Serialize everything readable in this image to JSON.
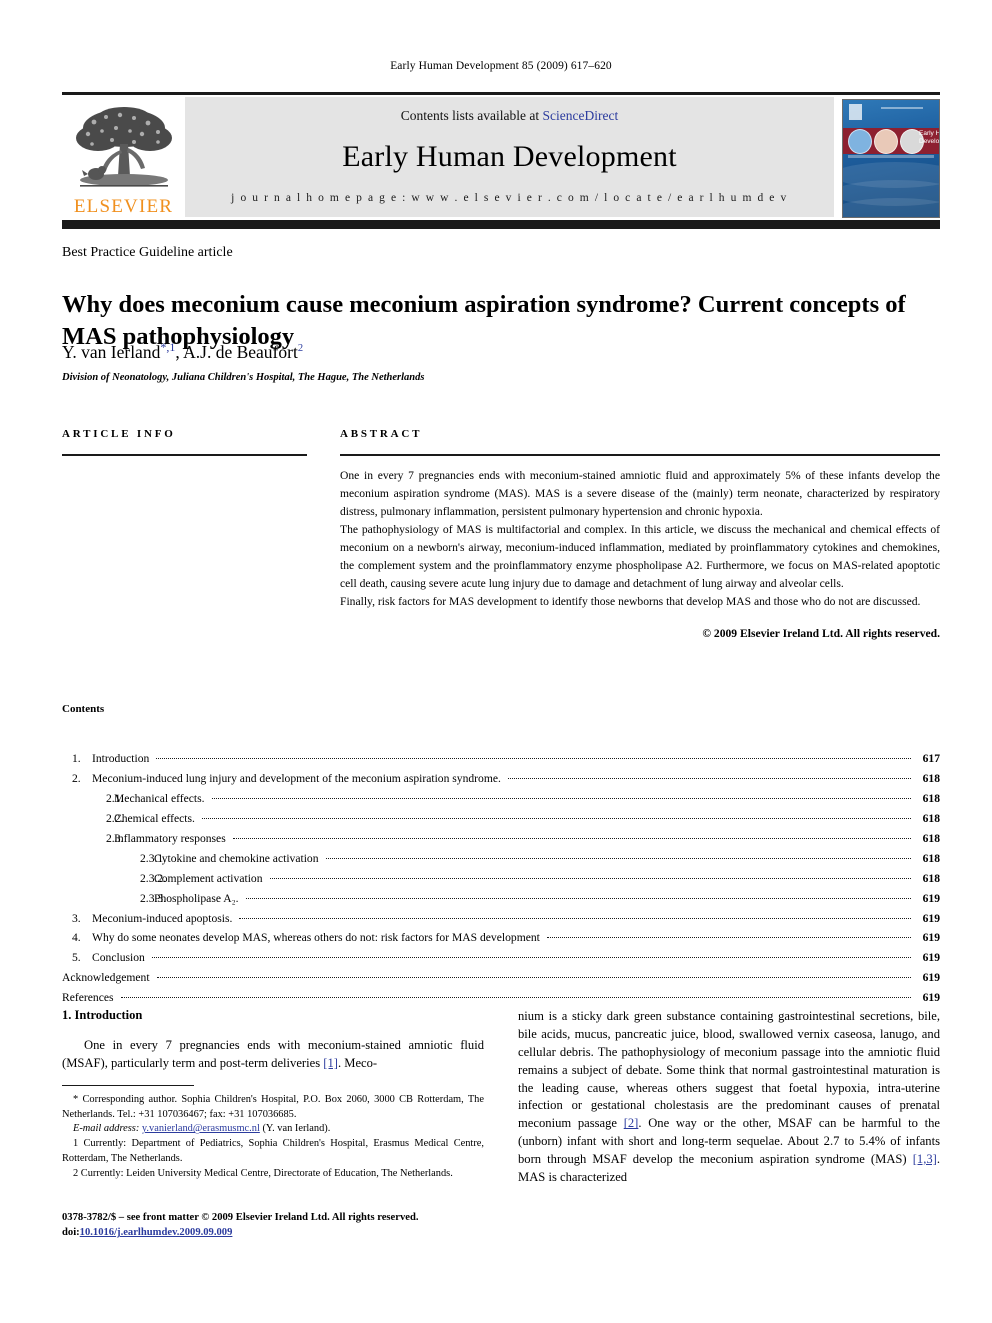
{
  "running_head": "Early Human Development 85 (2009) 617–620",
  "masthead": {
    "contents_prefix": "Contents lists available at ",
    "sciencedirect": "ScienceDirect",
    "journal_title": "Early Human Development",
    "homepage": "j o u r n a l   h o m e p a g e :   w w w . e l s e v i e r . c o m / l o c a t e / e a r l h u m d e v",
    "publisher_word": "ELSEVIER",
    "publisher_logo_icon": "elsevier-tree-icon",
    "cover_title_line1": "Early Human",
    "cover_title_line2": "Development",
    "accent_link_color": "#2b3b9e",
    "elsevier_orange": "#f0901e",
    "cover_band_color": "#8d2030"
  },
  "article": {
    "type": "Best Practice Guideline article",
    "title": "Why does meconium cause meconium aspiration syndrome? Current concepts of MAS pathophysiology",
    "author1": "Y. van Ierland",
    "author1_marks": "*,1",
    "author_sep": ", ",
    "author2": "A.J. de Beaufort",
    "author2_marks": "2",
    "affiliation": "Division of Neonatology, Juliana Children's Hospital, The Hague, The Netherlands"
  },
  "info_abstract": {
    "info_heading": "ARTICLE INFO",
    "abstract_heading": "ABSTRACT",
    "abstract_paragraphs": [
      "One in every 7 pregnancies ends with meconium-stained amniotic fluid and approximately 5% of these infants develop the meconium aspiration syndrome (MAS). MAS is a severe disease of the (mainly) term neonate, characterized by respiratory distress, pulmonary inflammation, persistent pulmonary hypertension and chronic hypoxia.",
      "The pathophysiology of MAS is multifactorial and complex. In this article, we discuss the mechanical and chemical effects of meconium on a newborn's airway, meconium-induced inflammation, mediated by proinflammatory cytokines and chemokines, the complement system and the proinflammatory enzyme phospholipase A2. Furthermore, we focus on MAS-related apoptotic cell death, causing severe acute lung injury due to damage and detachment of lung airway and alveolar cells.",
      "Finally, risk factors for MAS development to identify those newborns that develop MAS and those who do not are discussed."
    ],
    "copyright": "© 2009 Elsevier Ireland Ltd. All rights reserved."
  },
  "contents": {
    "label": "Contents",
    "entries": [
      {
        "level": 1,
        "num": "1.",
        "label": "Introduction",
        "page": "617"
      },
      {
        "level": 1,
        "num": "2.",
        "label": "Meconium-induced lung injury and development of the meconium aspiration syndrome.",
        "page": "618"
      },
      {
        "level": 2,
        "num": "2.1.",
        "label": "Mechanical effects.",
        "page": "618"
      },
      {
        "level": 2,
        "num": "2.2.",
        "label": "Chemical effects.",
        "page": "618"
      },
      {
        "level": 2,
        "num": "2.3.",
        "label": "Inflammatory responses",
        "page": "618"
      },
      {
        "level": 3,
        "num": "2.3.1.",
        "label": "Cytokine and chemokine activation",
        "page": "618"
      },
      {
        "level": 3,
        "num": "2.3.2.",
        "label": "Complement activation",
        "page": "618"
      },
      {
        "level": 3,
        "num": "2.3.3.",
        "label": "Phospholipase A₂.",
        "page": "619"
      },
      {
        "level": 1,
        "num": "3.",
        "label": "Meconium-induced apoptosis.",
        "page": "619"
      },
      {
        "level": 1,
        "num": "4.",
        "label": "Why do some neonates develop MAS, whereas others do not: risk factors for MAS development",
        "page": "619"
      },
      {
        "level": 1,
        "num": "5.",
        "label": "Conclusion",
        "page": "619"
      },
      {
        "level": 0,
        "num": "",
        "label": "Acknowledgement",
        "page": "619"
      },
      {
        "level": 0,
        "num": "",
        "label": "References",
        "page": "619"
      }
    ]
  },
  "body": {
    "section_heading": "1. Introduction",
    "left_para_part1": "One in every 7 pregnancies ends with meconium-stained amniotic fluid (MSAF), particularly term and post-term deliveries ",
    "left_para_ref1": "[1]",
    "left_para_part2": ". Meco-",
    "right_para_part1": "nium is a sticky dark green substance containing gastrointestinal secretions, bile, bile acids, mucus, pancreatic juice, blood, swallowed vernix caseosa, lanugo, and cellular debris. The pathophysiology of meconium passage into the amniotic fluid remains a subject of debate. Some think that normal gastrointestinal maturation is the leading cause, whereas others suggest that foetal hypoxia, intra-uterine infection or gestational cholestasis are the predominant causes of prenatal meconium passage ",
    "right_para_ref1": "[2]",
    "right_para_part2": ". One way or the other, MSAF can be harmful to the (unborn) infant with short and long-term sequelae. About 2.7 to 5.4% of infants born through MSAF develop the meconium aspiration syndrome (MAS) ",
    "right_para_ref2": "[1,3]",
    "right_para_part3": ". MAS is characterized"
  },
  "footnotes": {
    "corresponding": "* Corresponding author. Sophia Children's Hospital, P.O. Box 2060, 3000 CB Rotterdam, The Netherlands. Tel.: +31 107036467; fax: +31 107036685.",
    "email_label": "E-mail address:",
    "email": "y.vanierland@erasmusmc.nl",
    "email_suffix": "(Y. van Ierland).",
    "fn1": "1 Currently: Department of Pediatrics, Sophia Children's Hospital, Erasmus Medical Centre, Rotterdam, The Netherlands.",
    "fn2": "2 Currently: Leiden University Medical Centre, Directorate of Education, The Netherlands."
  },
  "footer": {
    "issn_line": "0378-3782/$ – see front matter © 2009 Elsevier Ireland Ltd. All rights reserved.",
    "doi_label": "doi:",
    "doi_value": "10.1016/j.earlhumdev.2009.09.009"
  }
}
